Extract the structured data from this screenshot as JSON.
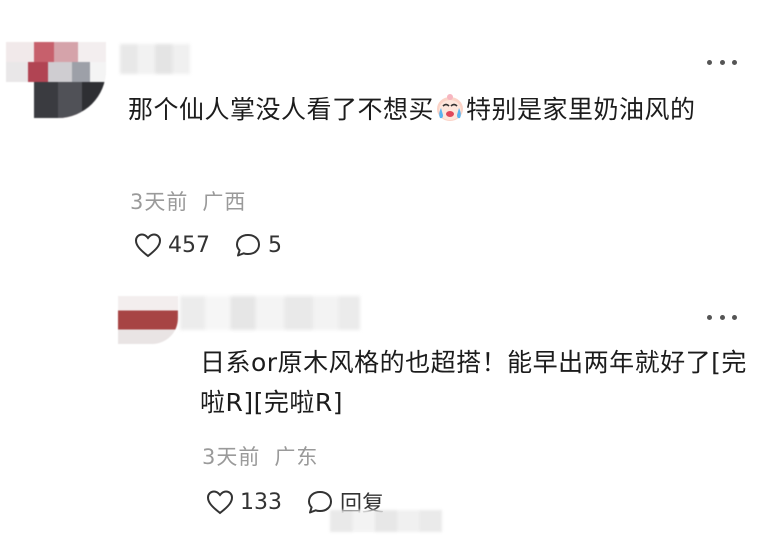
{
  "comment": {
    "text_before_emoji": "那个仙人掌没人看了不想买",
    "emoji": "crying-face-emoji",
    "text_after_emoji": "特别是家里奶油风的",
    "time": "3天前",
    "location": "广西",
    "likes": "457",
    "replies": "5"
  },
  "reply": {
    "text": "日系or原木风格的也超搭！能早出两年就好了[完啦R][完啦R]",
    "time": "3天前",
    "location": "广东",
    "likes": "133",
    "reply_label": "回复"
  },
  "colors": {
    "meta": "#9a9a9a",
    "text": "#1c1c1c",
    "icon": "#333333"
  }
}
